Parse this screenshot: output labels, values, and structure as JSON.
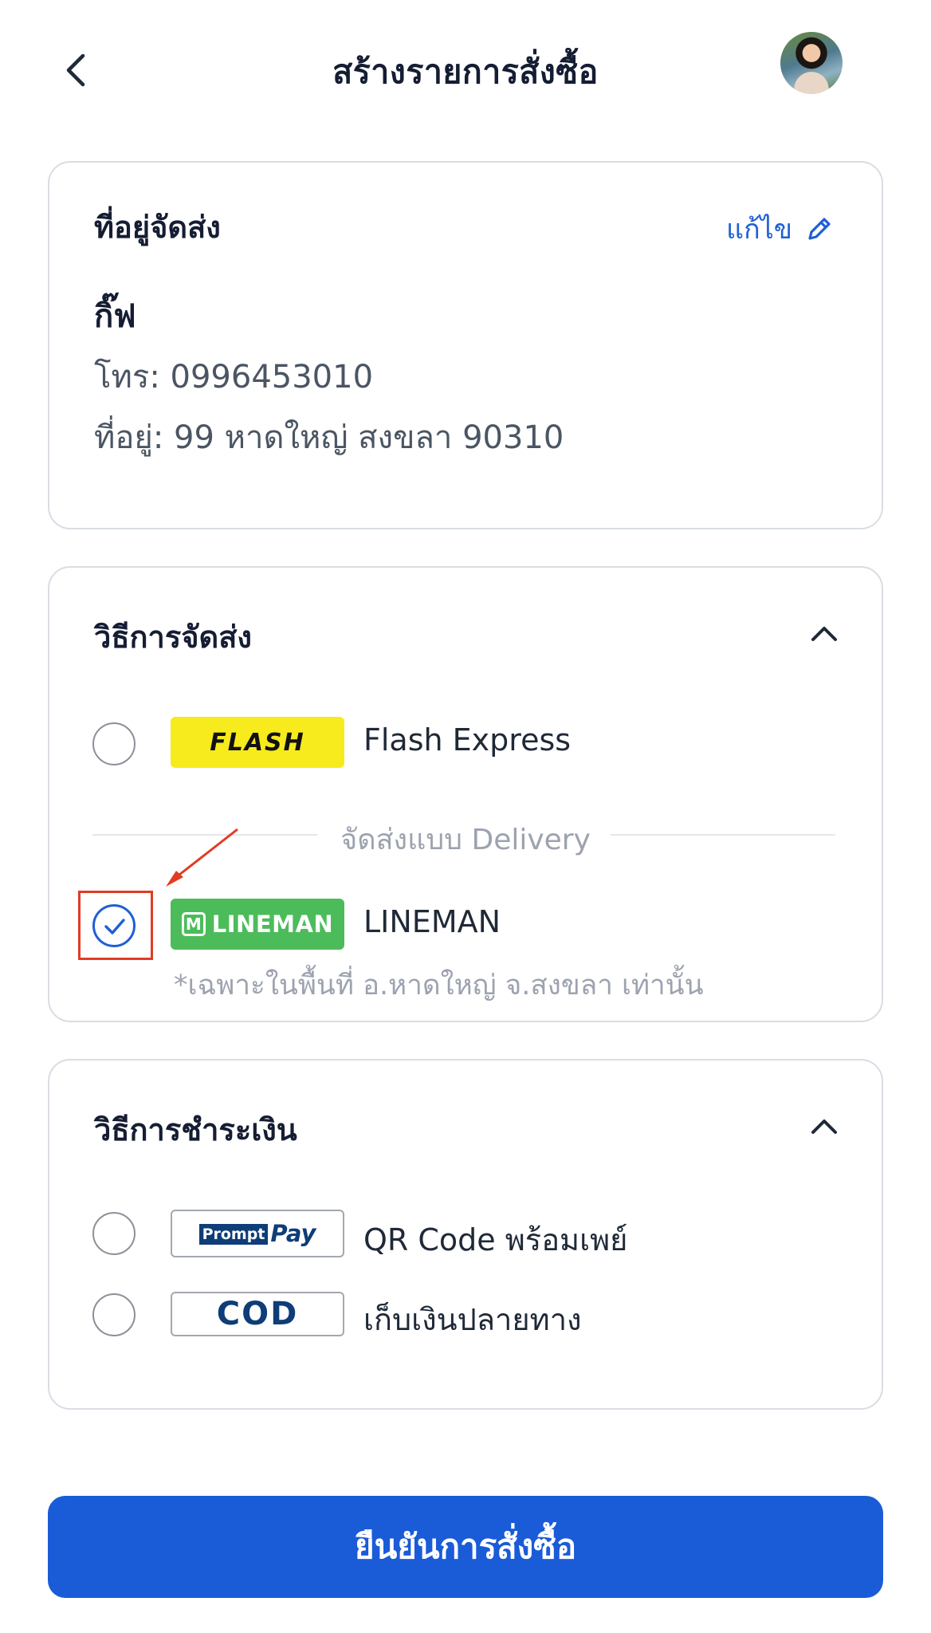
{
  "header": {
    "title": "สร้างรายการสั่งซื้อ"
  },
  "address": {
    "title": "ที่อยู่จัดส่ง",
    "edit_label": "แก้ไข",
    "name": "กิ๊ฟ",
    "phone": "โทร: 0996453010",
    "address": "ที่อยู่: 99 หาดใหญ่ สงขลา 90310"
  },
  "shipping": {
    "title": "วิธีการจัดส่ง",
    "divider": "จัดส่งแบบ Delivery",
    "options": [
      {
        "label": "Flash Express",
        "logo_text": "FLASH",
        "selected": false
      },
      {
        "label": "LINEMAN",
        "logo_text": "LINEMAN",
        "selected": true
      }
    ],
    "note": "*เฉพาะในพื้นที่ อ.หาดใหญ่ จ.สงขลา เท่านั้น"
  },
  "payment": {
    "title": "วิธีการชำระเงิน",
    "options": [
      {
        "label": "QR Code พร้อมเพย์",
        "logo_prompt": "Prompt",
        "logo_pay": "Pay",
        "selected": false
      },
      {
        "label": "เก็บเงินปลายทาง",
        "logo_text": "COD",
        "selected": false
      }
    ]
  },
  "confirm_label": "ยืนยันการสั่งซื้อ",
  "colors": {
    "accent": "#1a5bd8",
    "flash_yellow": "#f7ea1d",
    "lineman_green": "#4cbc5b",
    "annotation_red": "#e23b24"
  }
}
